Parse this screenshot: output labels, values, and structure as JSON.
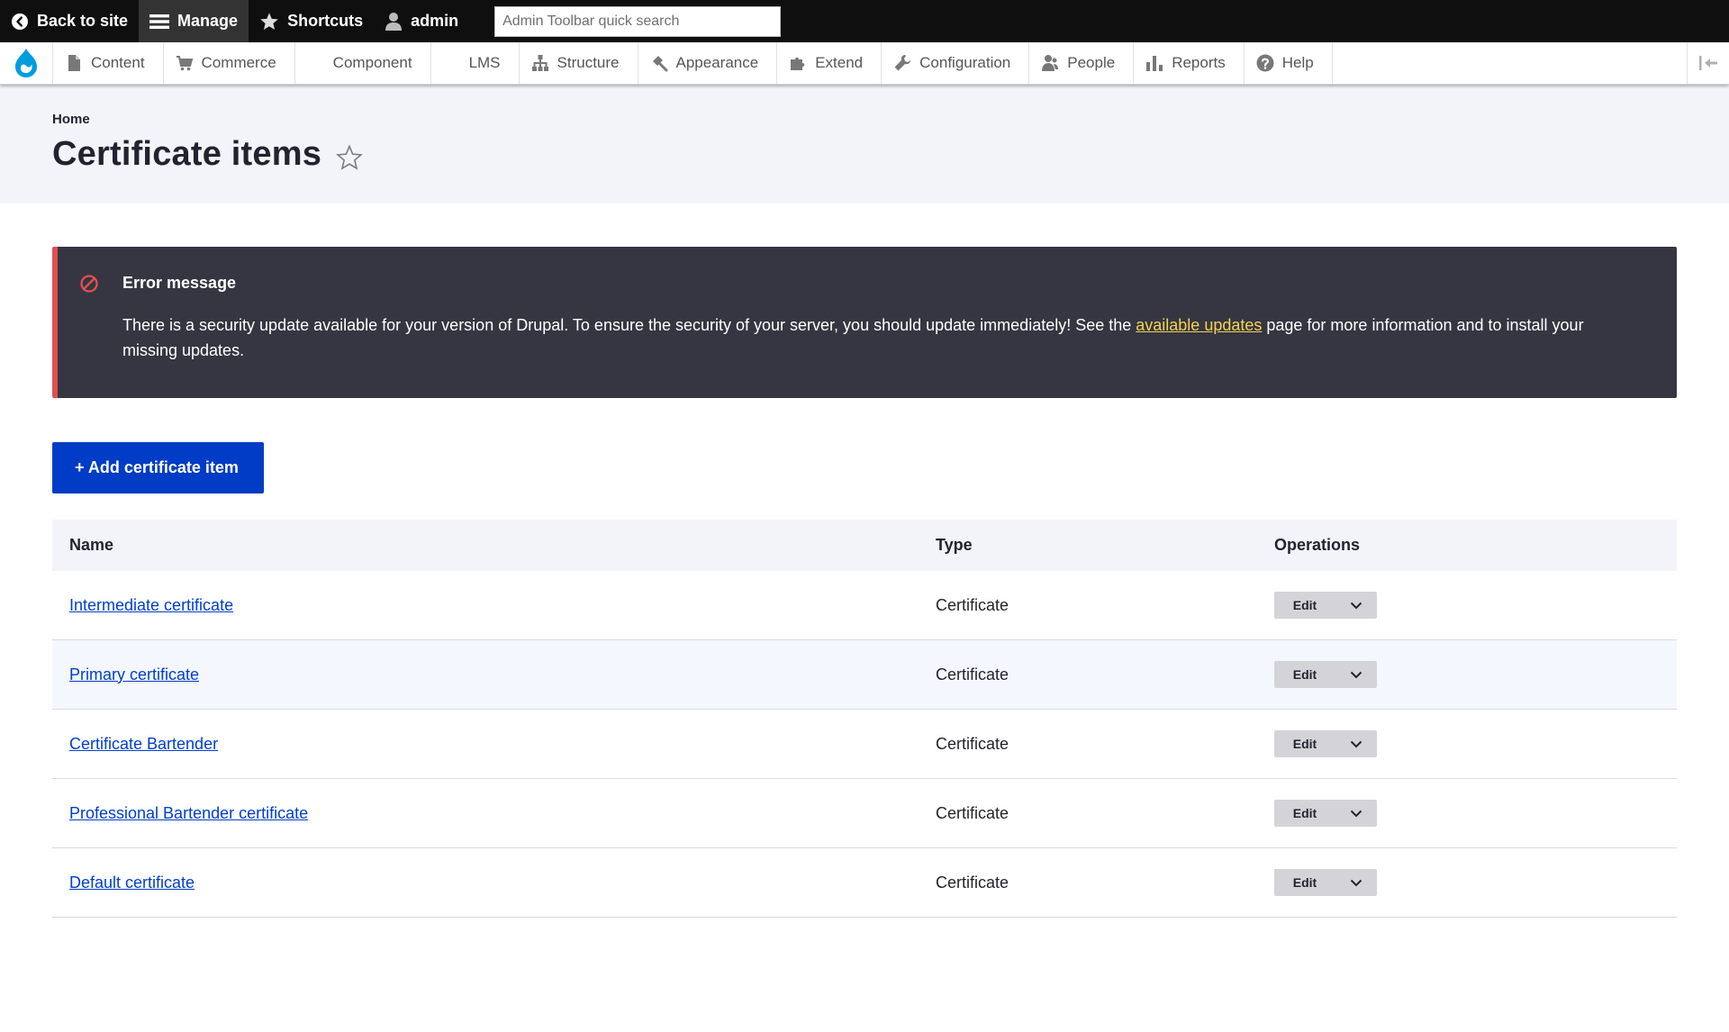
{
  "toolbar": {
    "back_to_site": "Back to site",
    "manage": "Manage",
    "shortcuts": "Shortcuts",
    "user": "admin",
    "search_placeholder": "Admin Toolbar quick search"
  },
  "tray": {
    "items": [
      {
        "label": "Content",
        "icon": "file-icon"
      },
      {
        "label": "Commerce",
        "icon": "cart-icon"
      },
      {
        "label": "Component",
        "icon": ""
      },
      {
        "label": "LMS",
        "icon": ""
      },
      {
        "label": "Structure",
        "icon": "sitemap-icon"
      },
      {
        "label": "Appearance",
        "icon": "paintbrush-icon"
      },
      {
        "label": "Extend",
        "icon": "puzzle-icon"
      },
      {
        "label": "Configuration",
        "icon": "wrench-icon"
      },
      {
        "label": "People",
        "icon": "people-icon"
      },
      {
        "label": "Reports",
        "icon": "bar-chart-icon"
      },
      {
        "label": "Help",
        "icon": "help-icon"
      }
    ]
  },
  "header": {
    "breadcrumb": "Home",
    "title": "Certificate items"
  },
  "message": {
    "title": "Error message",
    "text_before": "There is a security update available for your version of Drupal. To ensure the security of your server, you should update immediately! See the ",
    "link": "available updates",
    "text_after": " page for more information and to install your missing updates."
  },
  "add_button": "+ Add certificate item",
  "table": {
    "headers": [
      "Name",
      "Type",
      "Operations"
    ],
    "rows": [
      {
        "name": "Intermediate certificate",
        "type": "Certificate",
        "op": "Edit"
      },
      {
        "name": "Primary certificate",
        "type": "Certificate",
        "op": "Edit"
      },
      {
        "name": "Certificate Bartender",
        "type": "Certificate",
        "op": "Edit"
      },
      {
        "name": "Professional Bartender certificate",
        "type": "Certificate",
        "op": "Edit"
      },
      {
        "name": "Default certificate",
        "type": "Certificate",
        "op": "Edit"
      }
    ]
  },
  "colors": {
    "toolbar_bg": "#0f0f0f",
    "primary_button": "#003cc5",
    "message_bg": "#353641",
    "error_border": "#e34f4f",
    "message_link": "#f5d253",
    "link": "#003ecc"
  }
}
